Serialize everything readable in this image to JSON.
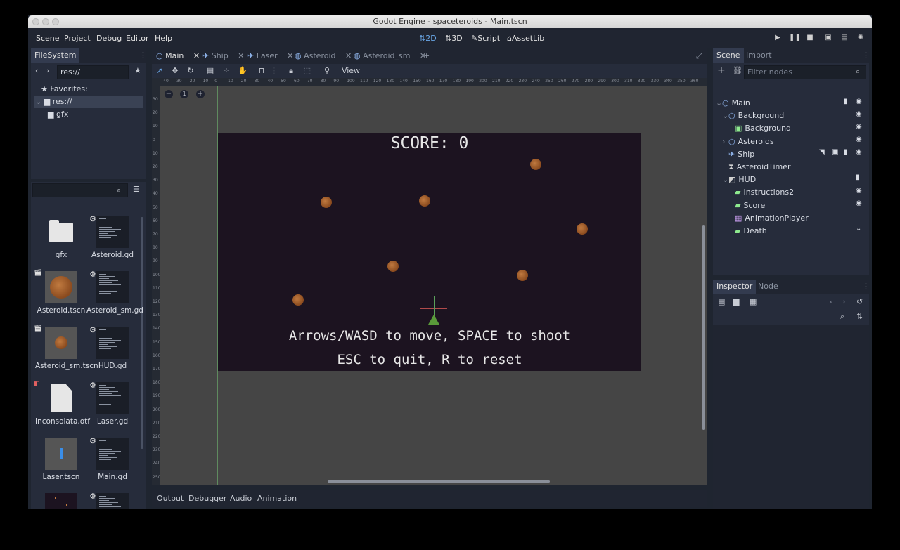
{
  "window": {
    "title": "Godot Engine - spaceteroids - Main.tscn"
  },
  "menus": [
    "Scene",
    "Project",
    "Debug",
    "Editor",
    "Help"
  ],
  "workspaces": [
    {
      "label": "2D",
      "active": true
    },
    {
      "label": "3D",
      "active": false
    },
    {
      "label": "Script",
      "active": false
    },
    {
      "label": "AssetLib",
      "active": false
    }
  ],
  "filesystem": {
    "tab": "FileSystem",
    "path": "res://",
    "tree": [
      {
        "label": "Favorites:",
        "icon": "star-icon"
      },
      {
        "label": "res://",
        "icon": "folder-icon",
        "selected": true
      },
      {
        "label": "gfx",
        "icon": "folder-icon"
      }
    ],
    "files": [
      {
        "name": "gfx",
        "type": "folder"
      },
      {
        "name": "Asteroid.gd",
        "type": "script"
      },
      {
        "name": "Asteroid.tscn",
        "type": "scene-asteroid"
      },
      {
        "name": "Asteroid_sm.gd",
        "type": "script"
      },
      {
        "name": "Asteroid_sm.tscn",
        "type": "scene-asteroid-small"
      },
      {
        "name": "HUD.gd",
        "type": "script"
      },
      {
        "name": "Inconsolata.otf",
        "type": "font"
      },
      {
        "name": "Laser.gd",
        "type": "script"
      },
      {
        "name": "Laser.tscn",
        "type": "scene-laser"
      },
      {
        "name": "Main.gd",
        "type": "script"
      },
      {
        "name": "",
        "type": "scene-main"
      },
      {
        "name": "",
        "type": "script"
      }
    ]
  },
  "editor_tabs": [
    {
      "label": "Main",
      "active": true
    },
    {
      "label": "Ship",
      "active": false
    },
    {
      "label": "Laser",
      "active": false
    },
    {
      "label": "Asteroid",
      "active": false
    },
    {
      "label": "Asteroid_sm",
      "active": false
    }
  ],
  "toolbar": {
    "view_label": "View"
  },
  "ruler_h": [
    "-40",
    "-30",
    "-20",
    "-10",
    "0",
    "10",
    "20",
    "30",
    "40",
    "50",
    "60",
    "70",
    "80",
    "90",
    "100",
    "110",
    "120",
    "130",
    "140",
    "150",
    "160",
    "170",
    "180",
    "190",
    "200",
    "210",
    "220",
    "230",
    "240",
    "250",
    "260",
    "270",
    "280",
    "290",
    "300",
    "310",
    "320",
    "330",
    "340",
    "350",
    "360"
  ],
  "ruler_v": [
    "30",
    "20",
    "10",
    "0",
    "10",
    "20",
    "30",
    "40",
    "50",
    "60",
    "70",
    "80",
    "90",
    "100",
    "110",
    "120",
    "130",
    "140",
    "150",
    "160",
    "170",
    "180",
    "190",
    "200",
    "210",
    "220",
    "230",
    "240",
    "250",
    "260"
  ],
  "zoom_label": "1",
  "game": {
    "score": "SCORE: 0",
    "instructions_1": "Arrows/WASD to move, SPACE to shoot",
    "instructions_2": "ESC to quit, R to reset"
  },
  "bottom_tabs": [
    "Output",
    "Debugger",
    "Audio",
    "Animation"
  ],
  "scene": {
    "tabs": [
      "Scene",
      "Import"
    ],
    "filter_placeholder": "Filter nodes",
    "nodes": [
      {
        "label": "Main",
        "indent": 0,
        "arrow": "v",
        "icon": "node2d-icon",
        "color": "#8eb3ea"
      },
      {
        "label": "Background",
        "indent": 1,
        "arrow": "v",
        "icon": "node2d-icon",
        "color": "#8eb3ea"
      },
      {
        "label": "Background",
        "indent": 2,
        "arrow": "",
        "icon": "texturerect-icon",
        "color": "#8eea8e"
      },
      {
        "label": "Asteroids",
        "indent": 1,
        "arrow": ">",
        "icon": "node2d-icon",
        "color": "#8eb3ea"
      },
      {
        "label": "Ship",
        "indent": 1,
        "arrow": "",
        "icon": "ship-icon",
        "color": "#8eb3ea"
      },
      {
        "label": "AsteroidTimer",
        "indent": 1,
        "arrow": "",
        "icon": "timer-icon",
        "color": "#d0d0d0"
      },
      {
        "label": "HUD",
        "indent": 1,
        "arrow": "v",
        "icon": "canvaslayer-icon",
        "color": "#d0d0d0"
      },
      {
        "label": "Instructions2",
        "indent": 2,
        "arrow": "",
        "icon": "label-icon",
        "color": "#8eea8e"
      },
      {
        "label": "Score",
        "indent": 2,
        "arrow": "",
        "icon": "label-icon",
        "color": "#8eea8e"
      },
      {
        "label": "AnimationPlayer",
        "indent": 2,
        "arrow": "",
        "icon": "animationplayer-icon",
        "color": "#c49aea"
      },
      {
        "label": "Death",
        "indent": 2,
        "arrow": "",
        "icon": "label-icon",
        "color": "#8eea8e"
      }
    ]
  },
  "inspector": {
    "tabs": [
      "Inspector",
      "Node"
    ]
  }
}
